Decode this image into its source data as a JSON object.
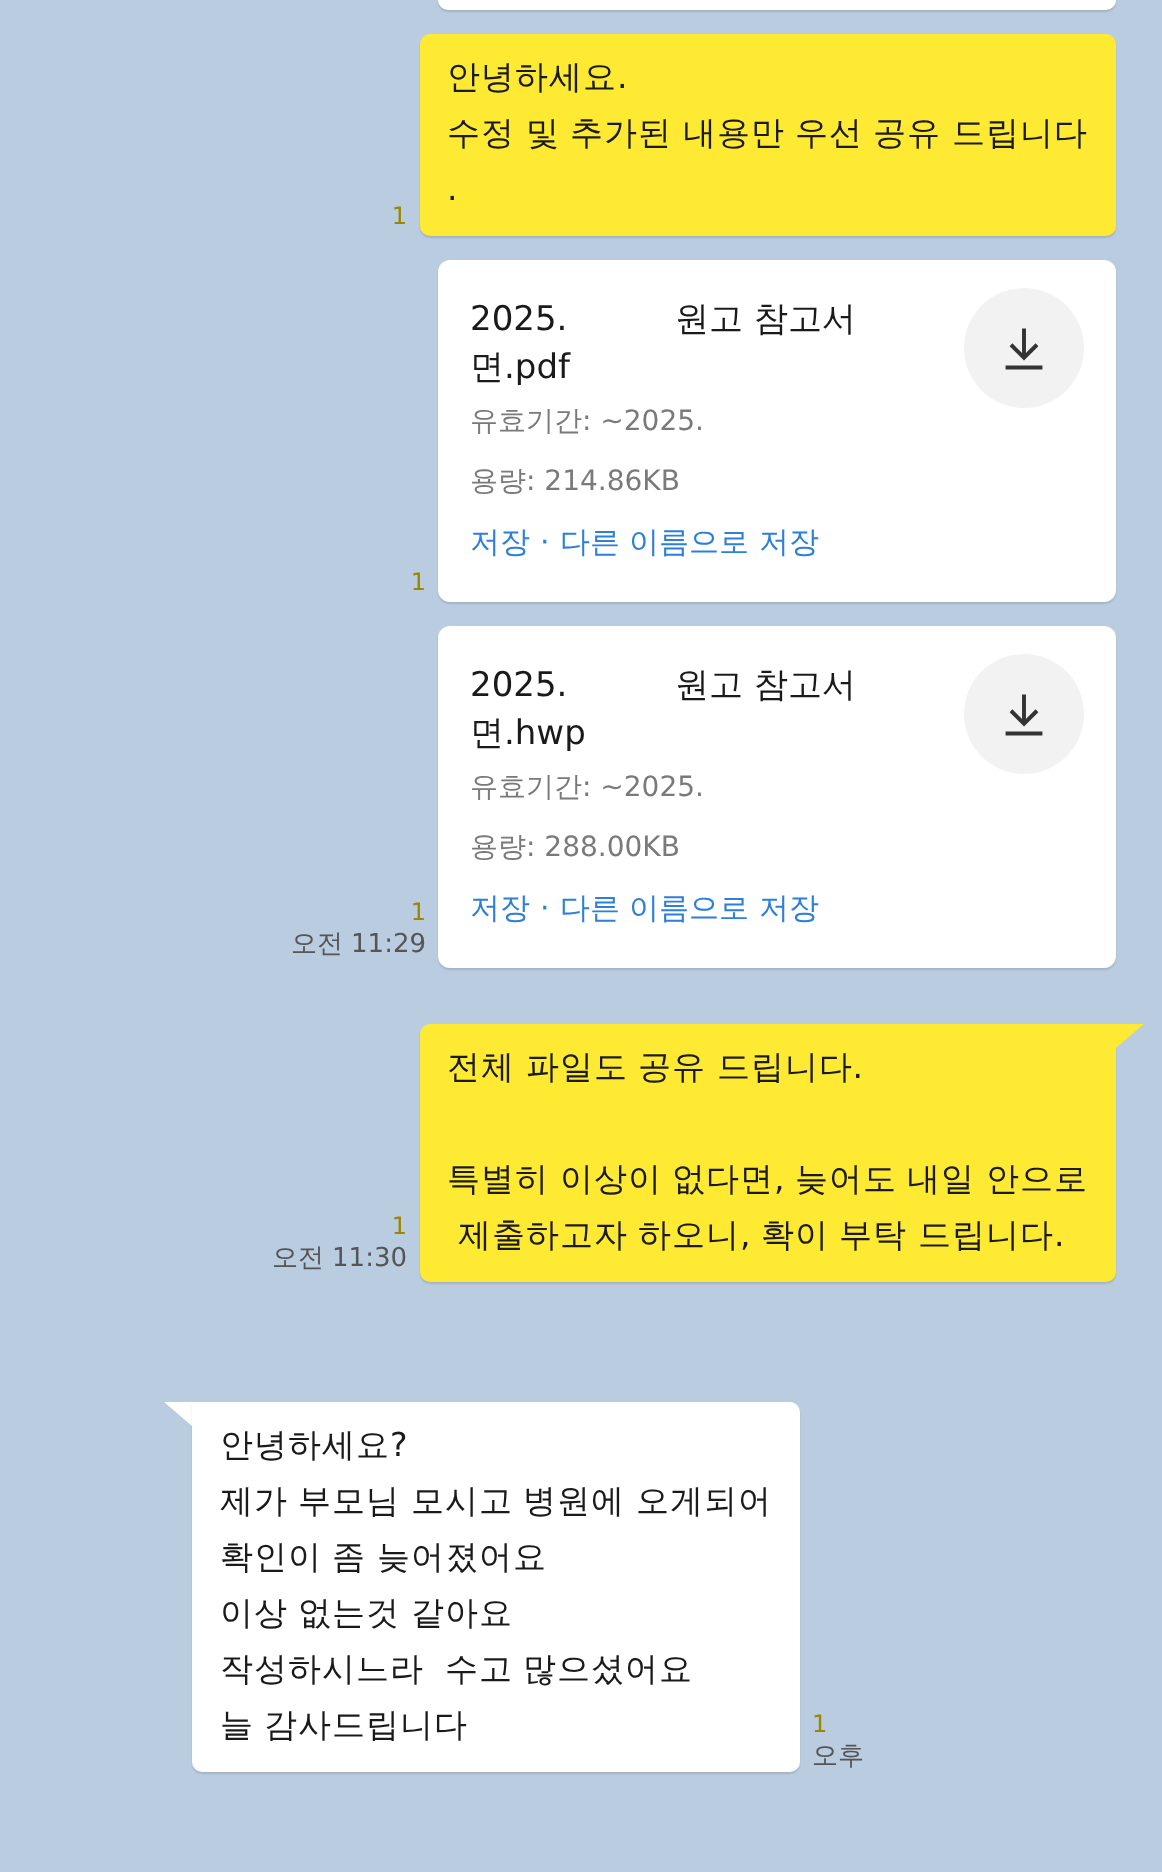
{
  "messages": [
    {
      "kind": "clipped_file"
    },
    {
      "kind": "text",
      "outgoing": true,
      "tail": false,
      "paragraphs": [
        [
          "안녕하세요.",
          "수정 및 추가된 내용만 우선 공유 드립니다",
          "."
        ]
      ],
      "unread": "1"
    },
    {
      "kind": "file",
      "outgoing": true,
      "name_lines": [
        "2025.          원고 참고서",
        "면.pdf"
      ],
      "validity": "유효기간: ~2025.",
      "size": "용량: 214.86KB",
      "save": "저장",
      "separator": "·",
      "save_as": "다른 이름으로 저장",
      "unread": "1"
    },
    {
      "kind": "file",
      "outgoing": true,
      "name_lines": [
        "2025.          원고 참고서",
        "면.hwp"
      ],
      "validity": "유효기간: ~2025.",
      "size": "용량: 288.00KB",
      "save": "저장",
      "separator": "·",
      "save_as": "다른 이름으로 저장",
      "unread": "1",
      "time": "오전 11:29"
    },
    {
      "kind": "text",
      "outgoing": true,
      "tail": true,
      "paragraphs": [
        [
          "전체 파일도 공유 드립니다."
        ],
        [
          "특별히 이상이 없다면, 늦어도 내일 안으로",
          " 제출하고자 하오니, 확이 부탁 드립니다."
        ]
      ],
      "unread": "1",
      "time": "오전 11:30"
    },
    {
      "kind": "text",
      "outgoing": false,
      "tail": true,
      "paragraphs": [
        [
          "안녕하세요?",
          "제가 부모님 모시고 병원에 오게되어",
          "확인이 좀 늦어졌어요",
          "이상 없는것 같아요",
          "작성하시느라  수고 많으셨어요",
          "늘 감사드립니다"
        ]
      ],
      "unread": "1",
      "time": "오후"
    }
  ]
}
